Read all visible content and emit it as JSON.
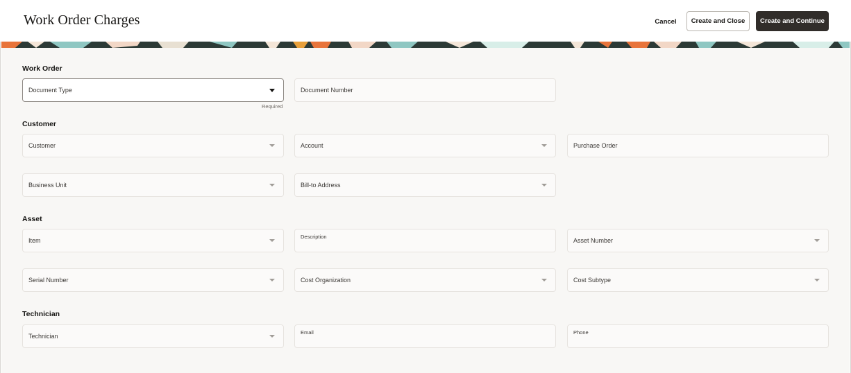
{
  "header": {
    "title": "Work Order Charges",
    "cancel_label": "Cancel",
    "create_close_label": "Create and Close",
    "create_continue_label": "Create and Continue"
  },
  "sections": {
    "work_order": {
      "title": "Work Order",
      "document_type": {
        "label": "Document Type",
        "hint": "Required",
        "icon": "chevron-down-icon"
      },
      "document_number": {
        "label": "Document Number"
      }
    },
    "customer": {
      "title": "Customer",
      "customer": {
        "label": "Customer",
        "icon": "chevron-down-icon"
      },
      "account": {
        "label": "Account",
        "icon": "chevron-down-icon"
      },
      "purchase_order": {
        "label": "Purchase Order"
      },
      "business_unit": {
        "label": "Business Unit",
        "icon": "chevron-down-icon"
      },
      "bill_to_address": {
        "label": "Bill-to Address",
        "icon": "chevron-down-icon"
      }
    },
    "asset": {
      "title": "Asset",
      "item": {
        "label": "Item",
        "icon": "chevron-down-icon"
      },
      "description": {
        "label": "Description"
      },
      "asset_number": {
        "label": "Asset Number",
        "icon": "chevron-down-icon"
      },
      "serial_number": {
        "label": "Serial Number",
        "icon": "chevron-down-icon"
      },
      "cost_organization": {
        "label": "Cost Organization",
        "icon": "chevron-down-icon"
      },
      "cost_subtype": {
        "label": "Cost Subtype",
        "icon": "chevron-down-icon"
      }
    },
    "technician": {
      "title": "Technician",
      "technician": {
        "label": "Technician",
        "icon": "chevron-down-icon"
      },
      "email": {
        "label": "Email"
      },
      "phone": {
        "label": "Phone"
      }
    }
  },
  "colors": {
    "primary_button": "#312d2a",
    "page_background": "#f8f7f5",
    "banner_dark": "#2c3a36",
    "banner_orange": "#e8743b",
    "banner_teal": "#8fc7c2"
  }
}
